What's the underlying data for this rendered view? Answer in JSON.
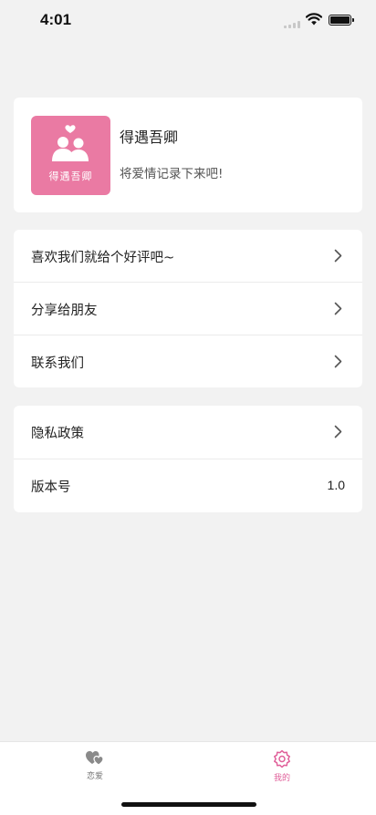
{
  "status_bar": {
    "time": "4:01"
  },
  "profile": {
    "logo_text": "得遇吾卿",
    "name": "得遇吾卿",
    "slogan": "将爱情记录下来吧!"
  },
  "menu_group_1": [
    {
      "label": "喜欢我们就给个好评吧~"
    },
    {
      "label": "分享给朋友"
    },
    {
      "label": "联系我们"
    }
  ],
  "menu_group_2": {
    "privacy_label": "隐私政策",
    "version_label": "版本号",
    "version_value": "1.0"
  },
  "tab_bar": {
    "tabs": [
      {
        "label": "恋爱",
        "icon": "hearts-icon",
        "active": false
      },
      {
        "label": "我的",
        "icon": "gear-icon",
        "active": true
      }
    ],
    "active_color": "#e0609a",
    "inactive_color": "#777777"
  },
  "colors": {
    "brand": "#ea7aa3",
    "background": "#f2f2f2"
  }
}
